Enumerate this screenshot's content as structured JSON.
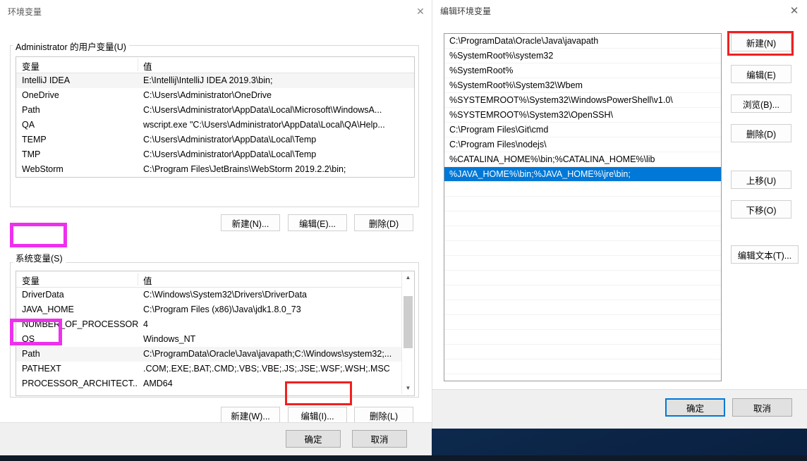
{
  "desktop": {
    "background_color": "#0b2545"
  },
  "env_dialog": {
    "title": "环境变量",
    "close_icon": "close-icon",
    "user_section": {
      "label": "Administrator 的用户变量(U)",
      "columns": [
        "变量",
        "值"
      ],
      "rows": [
        {
          "name": "IntelliJ IDEA",
          "value": "E:\\Intellij\\IntelliJ IDEA 2019.3\\bin;"
        },
        {
          "name": "OneDrive",
          "value": "C:\\Users\\Administrator\\OneDrive"
        },
        {
          "name": "Path",
          "value": "C:\\Users\\Administrator\\AppData\\Local\\Microsoft\\WindowsA..."
        },
        {
          "name": "QA",
          "value": "wscript.exe \"C:\\Users\\Administrator\\AppData\\Local\\QA\\Help..."
        },
        {
          "name": "TEMP",
          "value": "C:\\Users\\Administrator\\AppData\\Local\\Temp"
        },
        {
          "name": "TMP",
          "value": "C:\\Users\\Administrator\\AppData\\Local\\Temp"
        },
        {
          "name": "WebStorm",
          "value": "C:\\Program Files\\JetBrains\\WebStorm 2019.2.2\\bin;"
        }
      ],
      "buttons": {
        "new": "新建(N)...",
        "edit": "编辑(E)...",
        "delete": "删除(D)"
      }
    },
    "system_section": {
      "label": "系统变量(S)",
      "columns": [
        "变量",
        "值"
      ],
      "rows": [
        {
          "name": "DriverData",
          "value": "C:\\Windows\\System32\\Drivers\\DriverData"
        },
        {
          "name": "JAVA_HOME",
          "value": "C:\\Program Files (x86)\\Java\\jdk1.8.0_73"
        },
        {
          "name": "NUMBER_OF_PROCESSORS",
          "value": "4"
        },
        {
          "name": "OS",
          "value": "Windows_NT"
        },
        {
          "name": "Path",
          "value": "C:\\ProgramData\\Oracle\\Java\\javapath;C:\\Windows\\system32;..."
        },
        {
          "name": "PATHEXT",
          "value": ".COM;.EXE;.BAT;.CMD;.VBS;.VBE;.JS;.JSE;.WSF;.WSH;.MSC"
        },
        {
          "name": "PROCESSOR_ARCHITECT...",
          "value": "AMD64"
        }
      ],
      "buttons": {
        "new": "新建(W)...",
        "edit": "编辑(I)...",
        "delete": "删除(L)"
      }
    },
    "footer": {
      "ok": "确定",
      "cancel": "取消"
    }
  },
  "edit_dialog": {
    "title": "编辑环境变量",
    "close_icon": "close-icon",
    "path_entries": [
      "C:\\ProgramData\\Oracle\\Java\\javapath",
      "%SystemRoot%\\system32",
      "%SystemRoot%",
      "%SystemRoot%\\System32\\Wbem",
      "%SYSTEMROOT%\\System32\\WindowsPowerShell\\v1.0\\",
      "%SYSTEMROOT%\\System32\\OpenSSH\\",
      "C:\\Program Files\\Git\\cmd",
      "C:\\Program Files\\nodejs\\",
      "%CATALINA_HOME%\\bin;%CATALINA_HOME%\\lib",
      "%JAVA_HOME%\\bin;%JAVA_HOME%\\jre\\bin;"
    ],
    "selected_index": 9,
    "side_buttons": {
      "new": "新建(N)",
      "edit": "编辑(E)",
      "browse": "浏览(B)...",
      "delete": "删除(D)",
      "move_up": "上移(U)",
      "move_down": "下移(O)",
      "edit_text": "编辑文本(T)..."
    },
    "footer": {
      "ok": "确定",
      "cancel": "取消"
    }
  },
  "annotations": {
    "selection_color": "#0078d7",
    "red_box_color": "#f02020",
    "magenta_box_color": "#ee30ee",
    "red_boxes": [
      "新建(N)",
      "编辑(I)..."
    ],
    "magenta_boxes": [
      "系统变量(S)",
      "Path"
    ]
  }
}
